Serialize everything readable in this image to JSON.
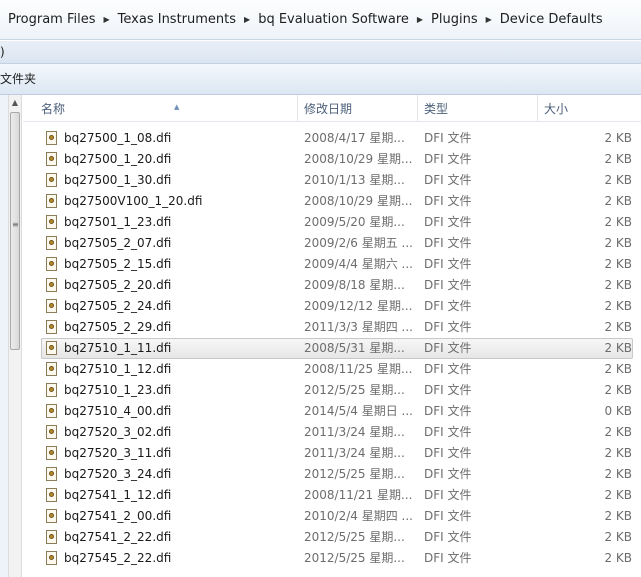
{
  "breadcrumb": {
    "items": [
      "Program Files",
      "Texas Instruments",
      "bq Evaluation Software",
      "Plugins",
      "Device Defaults"
    ]
  },
  "menubar": {
    "label": ")"
  },
  "toolbar": {
    "label": "文件夹"
  },
  "columns": {
    "name": "名称",
    "date": "修改日期",
    "type": "类型",
    "size": "大小"
  },
  "files": [
    {
      "name": "bq27500_1_08.dfi",
      "date": "2008/4/17 星期...",
      "type": "DFI 文件",
      "size": "2 KB"
    },
    {
      "name": "bq27500_1_20.dfi",
      "date": "2008/10/29 星期...",
      "type": "DFI 文件",
      "size": "2 KB"
    },
    {
      "name": "bq27500_1_30.dfi",
      "date": "2010/1/13 星期...",
      "type": "DFI 文件",
      "size": "2 KB"
    },
    {
      "name": "bq27500V100_1_20.dfi",
      "date": "2008/10/29 星期...",
      "type": "DFI 文件",
      "size": "2 KB"
    },
    {
      "name": "bq27501_1_23.dfi",
      "date": "2009/5/20 星期...",
      "type": "DFI 文件",
      "size": "2 KB"
    },
    {
      "name": "bq27505_2_07.dfi",
      "date": "2009/2/6 星期五 ...",
      "type": "DFI 文件",
      "size": "2 KB"
    },
    {
      "name": "bq27505_2_15.dfi",
      "date": "2009/4/4 星期六 ...",
      "type": "DFI 文件",
      "size": "2 KB"
    },
    {
      "name": "bq27505_2_20.dfi",
      "date": "2009/8/18 星期...",
      "type": "DFI 文件",
      "size": "2 KB"
    },
    {
      "name": "bq27505_2_24.dfi",
      "date": "2009/12/12 星期...",
      "type": "DFI 文件",
      "size": "2 KB"
    },
    {
      "name": "bq27505_2_29.dfi",
      "date": "2011/3/3 星期四 ...",
      "type": "DFI 文件",
      "size": "2 KB"
    },
    {
      "name": "bq27510_1_11.dfi",
      "date": "2008/5/31 星期...",
      "type": "DFI 文件",
      "size": "2 KB",
      "selected": true
    },
    {
      "name": "bq27510_1_12.dfi",
      "date": "2008/11/25 星期...",
      "type": "DFI 文件",
      "size": "2 KB"
    },
    {
      "name": "bq27510_1_23.dfi",
      "date": "2012/5/25 星期...",
      "type": "DFI 文件",
      "size": "2 KB"
    },
    {
      "name": "bq27510_4_00.dfi",
      "date": "2014/5/4 星期日 ...",
      "type": "DFI 文件",
      "size": "0 KB"
    },
    {
      "name": "bq27520_3_02.dfi",
      "date": "2011/3/24 星期...",
      "type": "DFI 文件",
      "size": "2 KB"
    },
    {
      "name": "bq27520_3_11.dfi",
      "date": "2011/3/24 星期...",
      "type": "DFI 文件",
      "size": "2 KB"
    },
    {
      "name": "bq27520_3_24.dfi",
      "date": "2012/5/25 星期...",
      "type": "DFI 文件",
      "size": "2 KB"
    },
    {
      "name": "bq27541_1_12.dfi",
      "date": "2008/11/21 星期...",
      "type": "DFI 文件",
      "size": "2 KB"
    },
    {
      "name": "bq27541_2_00.dfi",
      "date": "2010/2/4 星期四 ...",
      "type": "DFI 文件",
      "size": "2 KB"
    },
    {
      "name": "bq27541_2_22.dfi",
      "date": "2012/5/25 星期...",
      "type": "DFI 文件",
      "size": "2 KB"
    },
    {
      "name": "bq27545_2_22.dfi",
      "date": "2012/5/25 星期...",
      "type": "DFI 文件",
      "size": "2 KB"
    }
  ]
}
